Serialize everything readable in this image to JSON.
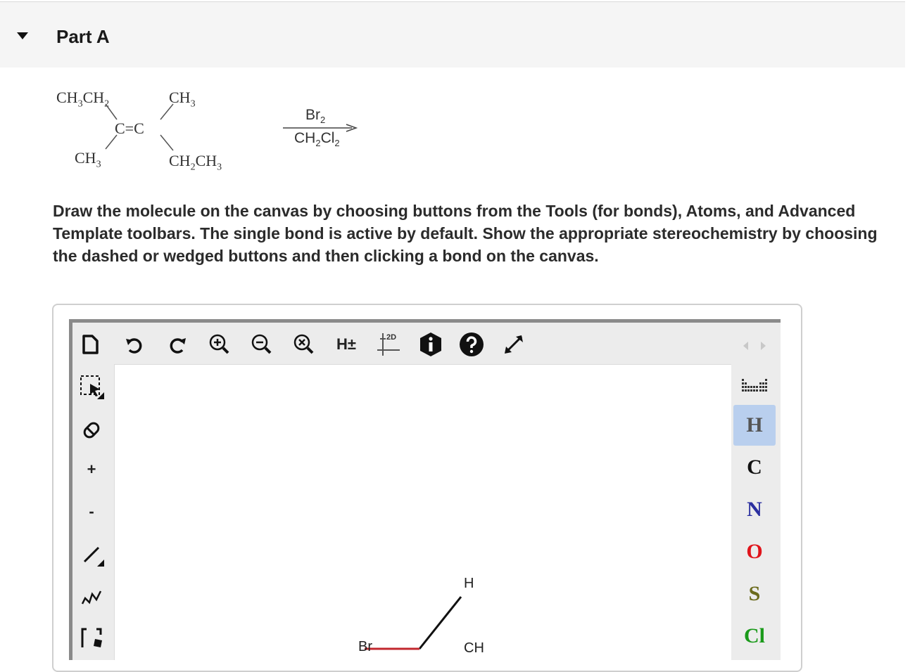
{
  "part": {
    "title": "Part A"
  },
  "reaction": {
    "reactant": {
      "top_left": [
        "CH",
        "3",
        "CH",
        "2"
      ],
      "top_right": [
        "CH",
        "3"
      ],
      "center": "C=C",
      "bottom_left": [
        "CH",
        "3"
      ],
      "bottom_right": [
        "CH",
        "2",
        "CH",
        "3"
      ]
    },
    "reagent_top": [
      "Br",
      "2"
    ],
    "reagent_bottom": [
      "CH",
      "2",
      "Cl",
      "2"
    ]
  },
  "instructions": "Draw the molecule on the canvas by choosing buttons from the Tools (for bonds), Atoms, and Advanced Template toolbars. The single bond is active by default. Show the appropriate stereochemistry by choosing the dashed or wedged buttons and then clicking a bond on the canvas.",
  "toolbar_top": {
    "hydrogen_toggle": "H±",
    "clean_label": "2D"
  },
  "toolbar_left": {
    "plus_label": "+",
    "minus_label": "-"
  },
  "atoms": [
    "H",
    "C",
    "N",
    "O",
    "S",
    "Cl"
  ],
  "atom_colors": {
    "H": "#555555",
    "C": "#111111",
    "N": "#2b2fa0",
    "O": "#e0141b",
    "S": "#6b6b1c",
    "Cl": "#1a9a1a"
  },
  "selected_atom": "H",
  "canvas_labels": {
    "h_label": "H",
    "br_label": "Br",
    "ch_label": "CH"
  }
}
